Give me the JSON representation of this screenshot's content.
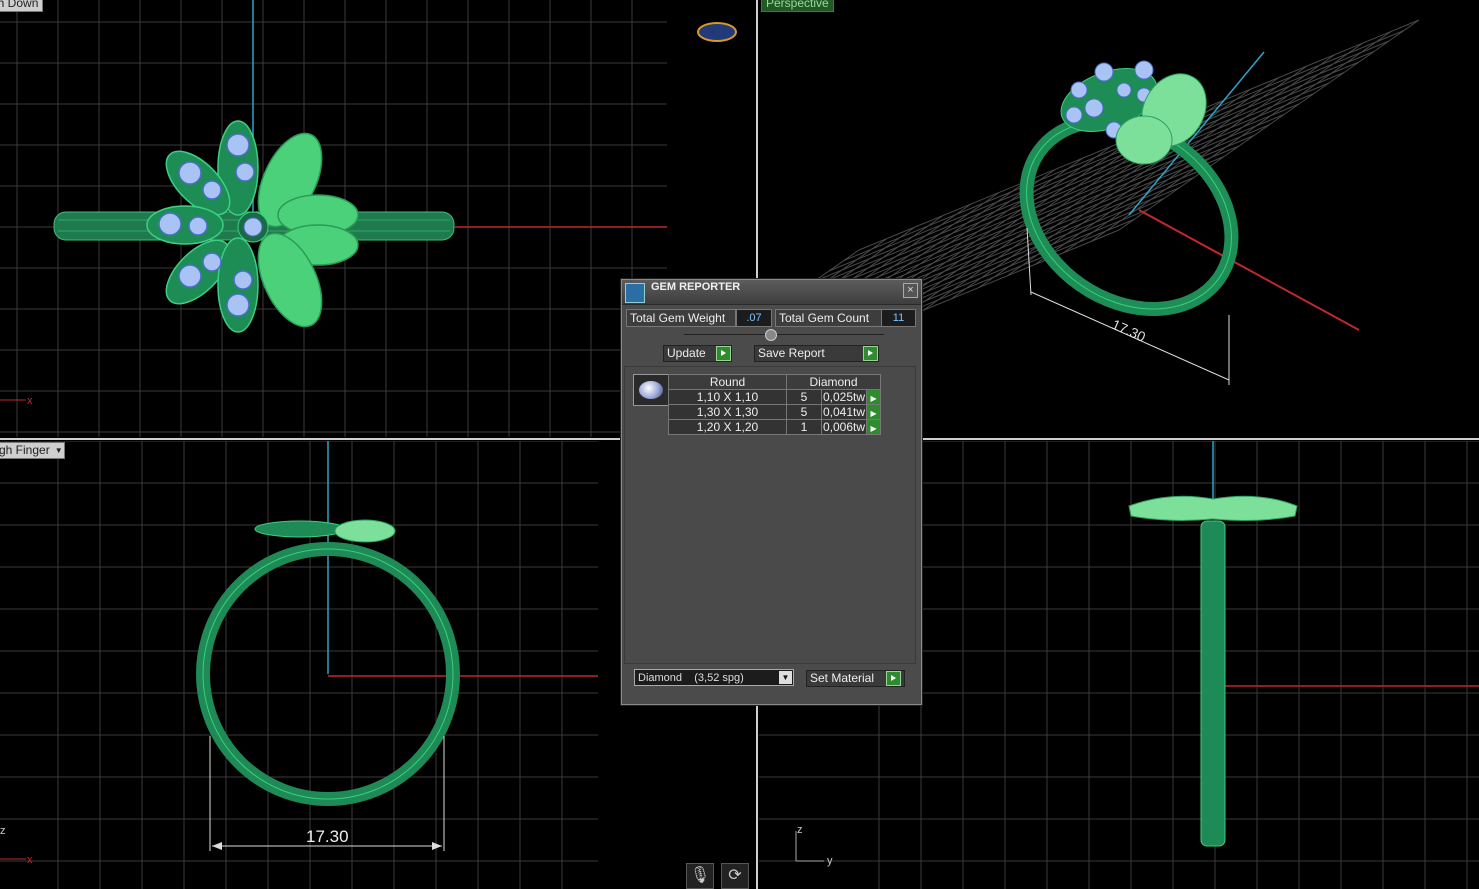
{
  "viewports": {
    "top_left_label": "gh Down",
    "top_right_label": "Perspective",
    "bottom_left_label": "gh Finger",
    "top_left_axis_x": "x",
    "bottom_left_axis_z": "z",
    "bottom_left_axis_x": "x",
    "bottom_right_axis_z": "z",
    "bottom_right_axis_y": "y",
    "dimension_front": "17.30",
    "dimension_perspective": "17.30"
  },
  "gem_reporter": {
    "title": "GEM REPORTER",
    "close": "×",
    "total_weight_label": "Total Gem Weight",
    "total_weight_value": ".07",
    "total_count_label": "Total Gem Count",
    "total_count_value": "11",
    "update_label": "Update",
    "save_report_label": "Save Report",
    "table": {
      "headers": [
        "Round",
        "Diamond"
      ],
      "rows": [
        {
          "size": "1,10 X 1,10",
          "count": "5",
          "weight": "0,025tw"
        },
        {
          "size": "1,30 X 1,30",
          "count": "5",
          "weight": "0,041tw"
        },
        {
          "size": "1,20 X 1,20",
          "count": "1",
          "weight": "0,006tw"
        }
      ]
    },
    "material_select": "Diamond    (3,52 spg)",
    "set_material_label": "Set Material"
  },
  "status_icons": [
    "microphone-icon",
    "refresh-icon"
  ]
}
